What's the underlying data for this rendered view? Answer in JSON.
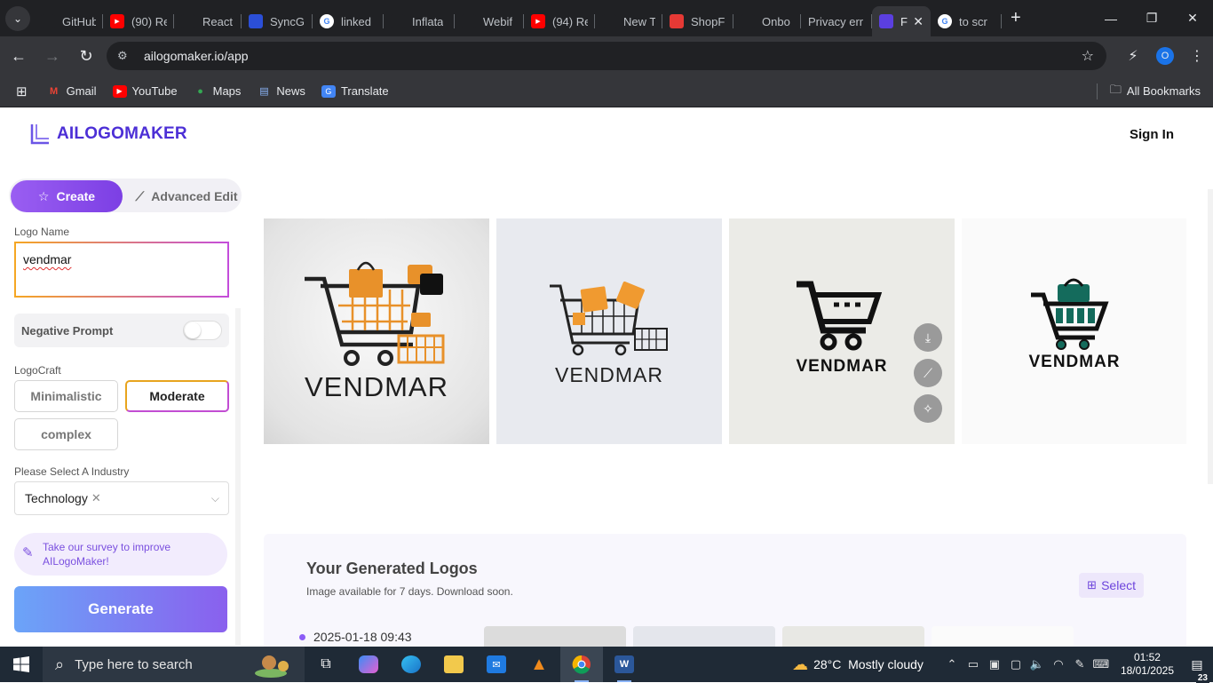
{
  "browser": {
    "tabs": [
      {
        "label": "GitHub",
        "icon": "github-icon",
        "color": "#202124"
      },
      {
        "label": "(90) Re",
        "icon": "youtube-icon",
        "color": "#ff0000"
      },
      {
        "label": "React",
        "icon": "react-icon",
        "color": "#202124"
      },
      {
        "label": "SyncG",
        "icon": "sync-icon",
        "color": "#2b4fd8"
      },
      {
        "label": "linked",
        "icon": "google-icon",
        "color": "#ffffff"
      },
      {
        "label": "Inflata",
        "icon": "discord-icon",
        "color": "#202124"
      },
      {
        "label": "Webif",
        "icon": "webflow-icon",
        "color": "#202124"
      },
      {
        "label": "(94) Re",
        "icon": "youtube-icon",
        "color": "#ff0000"
      },
      {
        "label": "New T",
        "icon": "chrome-icon",
        "color": "#202124"
      },
      {
        "label": "ShopF",
        "icon": "shop-icon",
        "color": "#e53935"
      },
      {
        "label": "Onbo",
        "icon": "monday-icon",
        "color": "#202124"
      },
      {
        "label": "Privacy err",
        "icon": "",
        "color": "#202124"
      },
      {
        "label": "Fr",
        "icon": "ailogomaker-icon",
        "color": "#5b3fe0",
        "active": true
      },
      {
        "label": "to scr",
        "icon": "google-icon",
        "color": "#ffffff"
      }
    ],
    "url": "ailogomaker.io/app",
    "profile_initial": "O",
    "bookmarks": [
      {
        "label": "Gmail",
        "icon": "gmail-icon"
      },
      {
        "label": "YouTube",
        "icon": "youtube-icon"
      },
      {
        "label": "Maps",
        "icon": "maps-icon"
      },
      {
        "label": "News",
        "icon": "news-icon"
      },
      {
        "label": "Translate",
        "icon": "translate-icon"
      }
    ],
    "all_bookmarks": "All Bookmarks"
  },
  "app": {
    "brand": "AILOGOMAKER",
    "sign_in": "Sign In",
    "mode_create": "Create",
    "mode_advanced": "Advanced Edit",
    "logo_name_label": "Logo Name",
    "logo_name_value": "vendmar",
    "negative_prompt": "Negative Prompt",
    "negative_prompt_enabled": false,
    "logocraft_label": "LogoCraft",
    "craft_options": [
      "Minimalistic",
      "Moderate",
      "complex"
    ],
    "craft_selected": "Moderate",
    "industry_label": "Please Select A Industry",
    "industry_value": "Technology",
    "survey_line1": "Take our survey to improve",
    "survey_line2": "AILogoMaker!",
    "generate": "Generate",
    "card_brand_text": "VENDMAR",
    "generated_title": "Your Generated Logos",
    "generated_subtitle": "Image available for 7 days. Download soon.",
    "select_label": "Select",
    "generated_date": "2025-01-18 09:43",
    "accent": "#7c3fe4"
  },
  "taskbar": {
    "search_placeholder": "Type here to search",
    "temperature": "28°C",
    "weather": "Mostly cloudy",
    "time": "01:52",
    "date": "18/01/2025",
    "notification_count": "23"
  }
}
